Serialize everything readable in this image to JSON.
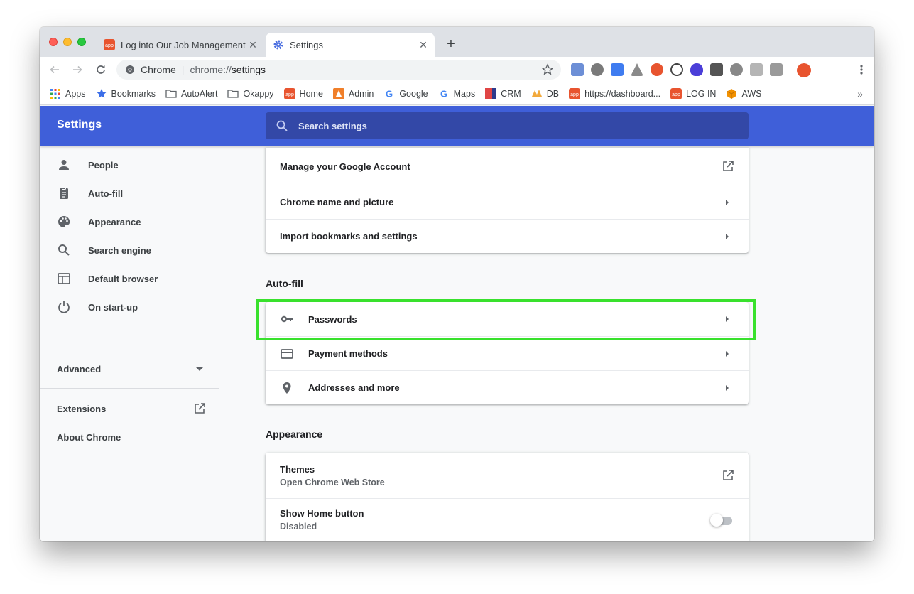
{
  "browser": {
    "tabs": [
      {
        "title": "Log into Our Job Management",
        "active": false
      },
      {
        "title": "Settings",
        "active": true
      }
    ],
    "omnibox": {
      "site_label": "Chrome",
      "url_prefix": "chrome://",
      "url_path": "settings"
    },
    "bookmarks": [
      {
        "label": "Apps",
        "icon": "apps-grid-icon"
      },
      {
        "label": "Bookmarks",
        "icon": "star-icon"
      },
      {
        "label": "AutoAlert",
        "icon": "folder-icon"
      },
      {
        "label": "Okappy",
        "icon": "folder-icon"
      },
      {
        "label": "Home",
        "icon": "app-favicon"
      },
      {
        "label": "Admin",
        "icon": "admin-favicon"
      },
      {
        "label": "Google",
        "icon": "google-icon"
      },
      {
        "label": "Maps",
        "icon": "google-icon"
      },
      {
        "label": "CRM",
        "icon": "crm-favicon"
      },
      {
        "label": "DB",
        "icon": "pma-favicon"
      },
      {
        "label": "https://dashboard...",
        "icon": "app-favicon"
      },
      {
        "label": "LOG IN",
        "icon": "app-favicon"
      },
      {
        "label": "AWS",
        "icon": "aws-icon"
      }
    ],
    "bookmarks_more": "»"
  },
  "settings": {
    "title": "Settings",
    "search_placeholder": "Search settings",
    "sidebar": {
      "items": [
        {
          "label": "People",
          "icon": "person-icon"
        },
        {
          "label": "Auto-fill",
          "icon": "clipboard-icon"
        },
        {
          "label": "Appearance",
          "icon": "palette-icon"
        },
        {
          "label": "Search engine",
          "icon": "search-icon"
        },
        {
          "label": "Default browser",
          "icon": "browser-window-icon"
        },
        {
          "label": "On start-up",
          "icon": "power-icon"
        }
      ],
      "advanced": "Advanced",
      "extensions": "Extensions",
      "about": "About Chrome"
    },
    "people_rows": [
      {
        "label": "Manage your Google Account"
      },
      {
        "label": "Chrome name and picture"
      },
      {
        "label": "Import bookmarks and settings"
      }
    ],
    "autofill": {
      "title": "Auto-fill",
      "rows": [
        {
          "label": "Passwords",
          "icon": "key-icon"
        },
        {
          "label": "Payment methods",
          "icon": "credit-card-icon"
        },
        {
          "label": "Addresses and more",
          "icon": "location-pin-icon"
        }
      ]
    },
    "appearance": {
      "title": "Appearance",
      "themes": {
        "label": "Themes",
        "sub": "Open Chrome Web Store"
      },
      "home_button": {
        "label": "Show Home button",
        "sub": "Disabled",
        "enabled": false
      }
    }
  },
  "colors": {
    "header": "#3f5fd9",
    "search": "#3348a7",
    "highlight": "#39e12d"
  }
}
